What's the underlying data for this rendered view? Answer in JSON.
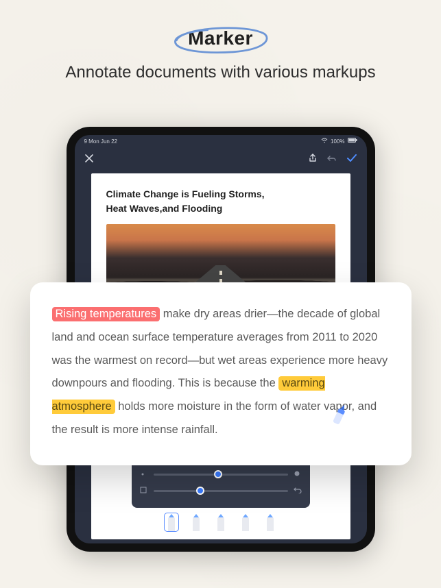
{
  "header": {
    "marker_label": "Marker",
    "subtitle": "Annotate documents with various markups"
  },
  "device": {
    "statusbar": {
      "time": "9 Mon Jun 22",
      "signal": "100%"
    },
    "document": {
      "title_line1": "Climate Change is Fueling Storms,",
      "title_line2": "Heat Waves,and Flooding"
    },
    "tool_panel": {
      "colors": [
        "#ff3b30",
        "#ff9500",
        "#34c759",
        "#007aff",
        "#5856d6",
        "#ff9ec0"
      ],
      "slider1_pct": 48,
      "slider2_pct": 35
    }
  },
  "excerpt": {
    "highlight_pink": "Rising temperatures",
    "seg1": " make dry areas drier—the decade of global land and ocean surface temperature averages from 2011 to 2020 was the warmest on record—but wet areas experience more heavy downpours and flooding. This is because the ",
    "highlight_yellow": "warming atmosphere",
    "seg2": " holds more moisture in the form of water vapor, and the result is more intense rainfall."
  }
}
